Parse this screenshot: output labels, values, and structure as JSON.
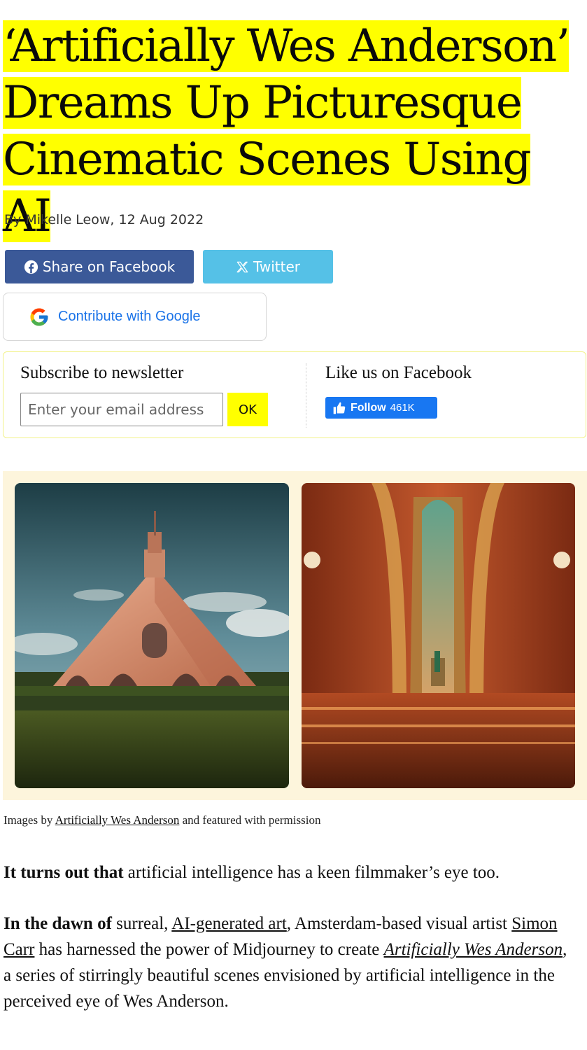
{
  "article": {
    "title_lines": [
      "‘Artificially Wes Anderson’",
      "Dreams Up Picturesque",
      "Cinematic Scenes Using AI"
    ],
    "byline": "By Mikelle Leow, 12 Aug 2022"
  },
  "share": {
    "facebook_label": "Share on Facebook",
    "twitter_label": "Twitter",
    "google_label": "Contribute with Google"
  },
  "newsletter": {
    "title": "Subscribe to newsletter",
    "email_placeholder": "Enter your email address",
    "ok_label": "OK"
  },
  "facebook_box": {
    "title": "Like us on Facebook",
    "follow_label": "Follow",
    "follow_count": "461K"
  },
  "caption": {
    "prefix": "Images by ",
    "link": "Artificially Wes Anderson",
    "suffix": " and featured with permission"
  },
  "body": {
    "p1_bold": "It turns out that",
    "p1_text": " artificial intelligence has a keen filmmaker’s eye too.",
    "p2_bold": "In the dawn of",
    "p2_t1": " surreal, ",
    "p2_link1": "AI-generated art",
    "p2_t2": ", Amsterdam-based visual artist ",
    "p2_link2": "Simon Carr",
    "p2_t3": " has harnessed the power of Midjourney to create ",
    "p2_link3": "Artificially Wes Anderson",
    "p2_t4": ", a series of stirringly beautiful scenes envisioned by artificial intelligence in the perceived eye of Wes Anderson."
  },
  "colors": {
    "highlight": "#ffff00",
    "facebook": "#3b5998",
    "twitter": "#55c1e7",
    "fb_follow": "#1877f2",
    "gallery_bg": "#fdf5dc"
  },
  "icons": [
    "facebook-icon",
    "x-logo-icon",
    "google-g-icon",
    "thumbs-up-icon"
  ]
}
